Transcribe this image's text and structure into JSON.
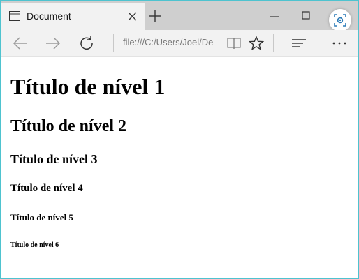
{
  "tab": {
    "title": "Document"
  },
  "address": {
    "url": "file:///C:/Users/Joel/De"
  },
  "icons": {
    "tab": "tab-page-icon",
    "close": "close-icon",
    "new_tab": "plus-icon",
    "minimize": "minimize-icon",
    "maximize": "maximize-icon",
    "extension": "screen-capture-icon",
    "back": "back-arrow-icon",
    "forward": "forward-arrow-icon",
    "refresh": "refresh-icon",
    "reading_view": "reading-view-icon",
    "favorite": "star-icon",
    "hub": "hub-lines-icon",
    "more": "more-dots-icon"
  },
  "colors": {
    "window_border": "#4ec3cf",
    "tabstrip": "#cfcfcf",
    "toolbar": "#f2f2f2",
    "extension_accent": "#2a7ab7"
  },
  "headings": {
    "h1": "Título de nível 1",
    "h2": "Título de nível 2",
    "h3": "Título de nível 3",
    "h4": "Título de nível 4",
    "h5": "Título de nível 5",
    "h6": "Título de nível 6"
  }
}
